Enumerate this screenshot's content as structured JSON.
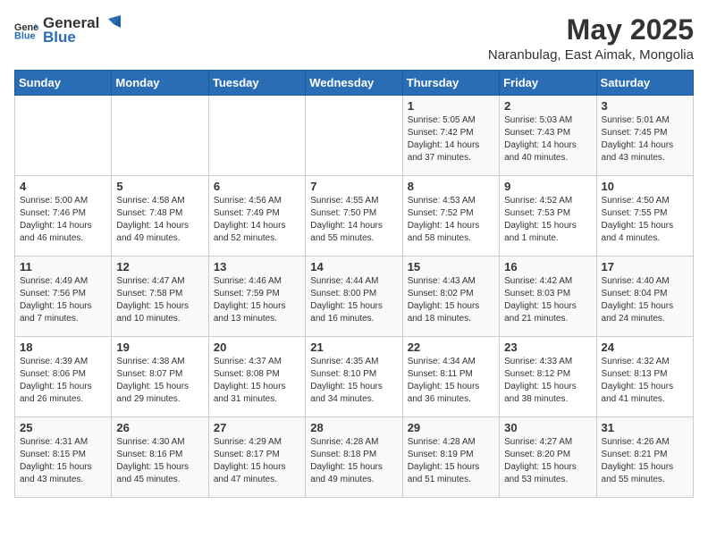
{
  "header": {
    "logo_general": "General",
    "logo_blue": "Blue",
    "title": "May 2025",
    "subtitle": "Naranbulag, East Aimak, Mongolia"
  },
  "weekdays": [
    "Sunday",
    "Monday",
    "Tuesday",
    "Wednesday",
    "Thursday",
    "Friday",
    "Saturday"
  ],
  "weeks": [
    [
      {
        "day": "",
        "info": ""
      },
      {
        "day": "",
        "info": ""
      },
      {
        "day": "",
        "info": ""
      },
      {
        "day": "",
        "info": ""
      },
      {
        "day": "1",
        "info": "Sunrise: 5:05 AM\nSunset: 7:42 PM\nDaylight: 14 hours\nand 37 minutes."
      },
      {
        "day": "2",
        "info": "Sunrise: 5:03 AM\nSunset: 7:43 PM\nDaylight: 14 hours\nand 40 minutes."
      },
      {
        "day": "3",
        "info": "Sunrise: 5:01 AM\nSunset: 7:45 PM\nDaylight: 14 hours\nand 43 minutes."
      }
    ],
    [
      {
        "day": "4",
        "info": "Sunrise: 5:00 AM\nSunset: 7:46 PM\nDaylight: 14 hours\nand 46 minutes."
      },
      {
        "day": "5",
        "info": "Sunrise: 4:58 AM\nSunset: 7:48 PM\nDaylight: 14 hours\nand 49 minutes."
      },
      {
        "day": "6",
        "info": "Sunrise: 4:56 AM\nSunset: 7:49 PM\nDaylight: 14 hours\nand 52 minutes."
      },
      {
        "day": "7",
        "info": "Sunrise: 4:55 AM\nSunset: 7:50 PM\nDaylight: 14 hours\nand 55 minutes."
      },
      {
        "day": "8",
        "info": "Sunrise: 4:53 AM\nSunset: 7:52 PM\nDaylight: 14 hours\nand 58 minutes."
      },
      {
        "day": "9",
        "info": "Sunrise: 4:52 AM\nSunset: 7:53 PM\nDaylight: 15 hours\nand 1 minute."
      },
      {
        "day": "10",
        "info": "Sunrise: 4:50 AM\nSunset: 7:55 PM\nDaylight: 15 hours\nand 4 minutes."
      }
    ],
    [
      {
        "day": "11",
        "info": "Sunrise: 4:49 AM\nSunset: 7:56 PM\nDaylight: 15 hours\nand 7 minutes."
      },
      {
        "day": "12",
        "info": "Sunrise: 4:47 AM\nSunset: 7:58 PM\nDaylight: 15 hours\nand 10 minutes."
      },
      {
        "day": "13",
        "info": "Sunrise: 4:46 AM\nSunset: 7:59 PM\nDaylight: 15 hours\nand 13 minutes."
      },
      {
        "day": "14",
        "info": "Sunrise: 4:44 AM\nSunset: 8:00 PM\nDaylight: 15 hours\nand 16 minutes."
      },
      {
        "day": "15",
        "info": "Sunrise: 4:43 AM\nSunset: 8:02 PM\nDaylight: 15 hours\nand 18 minutes."
      },
      {
        "day": "16",
        "info": "Sunrise: 4:42 AM\nSunset: 8:03 PM\nDaylight: 15 hours\nand 21 minutes."
      },
      {
        "day": "17",
        "info": "Sunrise: 4:40 AM\nSunset: 8:04 PM\nDaylight: 15 hours\nand 24 minutes."
      }
    ],
    [
      {
        "day": "18",
        "info": "Sunrise: 4:39 AM\nSunset: 8:06 PM\nDaylight: 15 hours\nand 26 minutes."
      },
      {
        "day": "19",
        "info": "Sunrise: 4:38 AM\nSunset: 8:07 PM\nDaylight: 15 hours\nand 29 minutes."
      },
      {
        "day": "20",
        "info": "Sunrise: 4:37 AM\nSunset: 8:08 PM\nDaylight: 15 hours\nand 31 minutes."
      },
      {
        "day": "21",
        "info": "Sunrise: 4:35 AM\nSunset: 8:10 PM\nDaylight: 15 hours\nand 34 minutes."
      },
      {
        "day": "22",
        "info": "Sunrise: 4:34 AM\nSunset: 8:11 PM\nDaylight: 15 hours\nand 36 minutes."
      },
      {
        "day": "23",
        "info": "Sunrise: 4:33 AM\nSunset: 8:12 PM\nDaylight: 15 hours\nand 38 minutes."
      },
      {
        "day": "24",
        "info": "Sunrise: 4:32 AM\nSunset: 8:13 PM\nDaylight: 15 hours\nand 41 minutes."
      }
    ],
    [
      {
        "day": "25",
        "info": "Sunrise: 4:31 AM\nSunset: 8:15 PM\nDaylight: 15 hours\nand 43 minutes."
      },
      {
        "day": "26",
        "info": "Sunrise: 4:30 AM\nSunset: 8:16 PM\nDaylight: 15 hours\nand 45 minutes."
      },
      {
        "day": "27",
        "info": "Sunrise: 4:29 AM\nSunset: 8:17 PM\nDaylight: 15 hours\nand 47 minutes."
      },
      {
        "day": "28",
        "info": "Sunrise: 4:28 AM\nSunset: 8:18 PM\nDaylight: 15 hours\nand 49 minutes."
      },
      {
        "day": "29",
        "info": "Sunrise: 4:28 AM\nSunset: 8:19 PM\nDaylight: 15 hours\nand 51 minutes."
      },
      {
        "day": "30",
        "info": "Sunrise: 4:27 AM\nSunset: 8:20 PM\nDaylight: 15 hours\nand 53 minutes."
      },
      {
        "day": "31",
        "info": "Sunrise: 4:26 AM\nSunset: 8:21 PM\nDaylight: 15 hours\nand 55 minutes."
      }
    ]
  ]
}
